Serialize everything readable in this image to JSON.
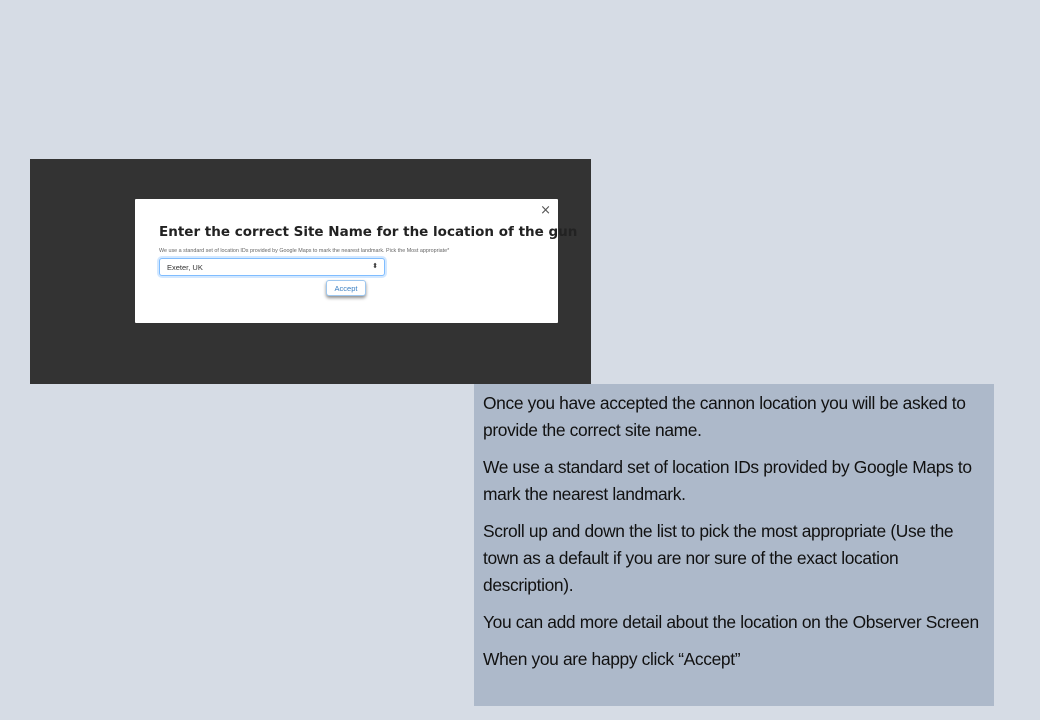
{
  "dialog": {
    "close_glyph": "×",
    "title": "Enter the correct Site Name for the location of the gun",
    "subtitle": "We use a standard set of location IDs provided by Google Maps to mark the nearest landmark. Pick the Most appropriate*",
    "select_value": "Exeter, UK",
    "select_arrows": "⬍",
    "accept_label": "Accept"
  },
  "notes": {
    "paragraphs": [
      "Once you have accepted the cannon location you will be asked to provide the correct site name.",
      "We use a standard set of location IDs provided by Google Maps to mark the nearest landmark.",
      "Scroll up and down the list to pick the most appropriate (Use the town as a default if you are nor sure of the exact location description).",
      "You can add more detail about the location on the Observer Screen",
      "When you are happy click “Accept”"
    ]
  },
  "colors": {
    "page_background": "#d6dce5",
    "screenshot_background": "#333333",
    "notes_background": "#adb9ca",
    "accent": "#80bdff"
  }
}
